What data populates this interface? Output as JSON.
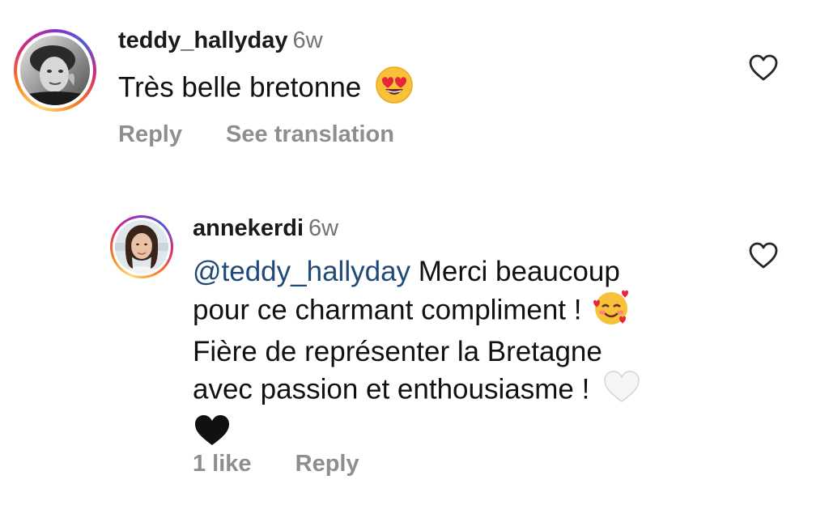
{
  "comments": [
    {
      "username": "teddy_hallyday",
      "time": "6w",
      "text": "Très belle bretonne",
      "emoji": "heart-eyes-emoji",
      "actions": {
        "reply": "Reply",
        "translate": "See translation"
      },
      "like_icon": "heart-outline-icon"
    },
    {
      "username": "annekerdi",
      "time": "6w",
      "mention": "@teddy_hallyday",
      "line1_rest": " Merci beaucoup",
      "line2": "pour ce charmant compliment !",
      "line3": "Fière de représenter la Bretagne",
      "line4": "avec passion et enthousiasme !",
      "emojis": [
        "smiling-face-with-hearts-emoji",
        "white-heart-emoji",
        "black-heart-emoji"
      ],
      "actions": {
        "likes": "1 like",
        "reply": "Reply"
      },
      "like_icon": "heart-outline-icon"
    }
  ],
  "colors": {
    "mention": "#1f4a75",
    "meta": "#737373",
    "action": "#8e8e8e"
  }
}
